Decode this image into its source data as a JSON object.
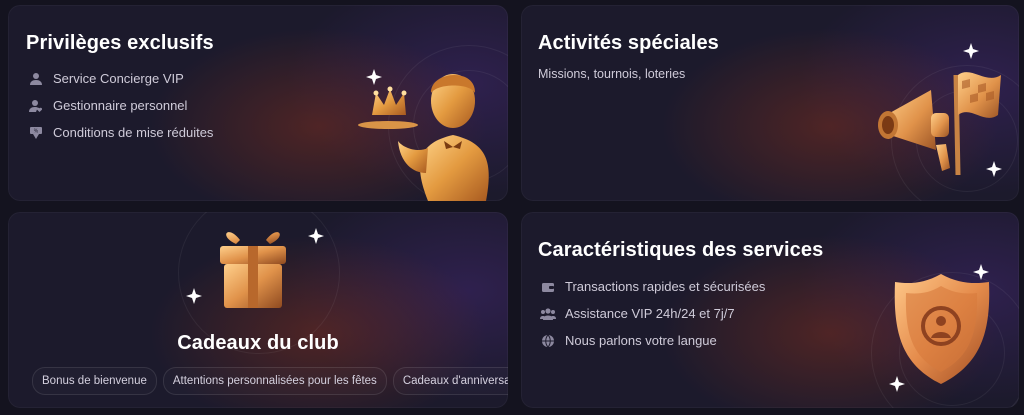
{
  "cards": {
    "privileges": {
      "title": "Privilèges exclusifs",
      "items": [
        {
          "label": "Service Concierge VIP",
          "icon": "person-icon"
        },
        {
          "label": "Gestionnaire personnel",
          "icon": "person-heart-icon"
        },
        {
          "label": "Conditions de mise réduites",
          "icon": "percent-banner-icon"
        }
      ]
    },
    "activities": {
      "title": "Activités spéciales",
      "subtitle": "Missions, tournois, loteries"
    },
    "gifts": {
      "title": "Cadeaux du club",
      "chips": [
        "Bonus de bienvenue",
        "Attentions personnalisées pour les fêtes",
        "Cadeaux d'anniversaire"
      ]
    },
    "services": {
      "title": "Caractéristiques des services",
      "items": [
        {
          "label": "Transactions rapides et sécurisées",
          "icon": "wallet-icon"
        },
        {
          "label": "Assistance VIP 24h/24 et 7j/7",
          "icon": "group-icon"
        },
        {
          "label": "Nous parlons votre langue",
          "icon": "globe-icon"
        }
      ]
    }
  },
  "colors": {
    "background": "#14131f",
    "card": "#1c1a2c",
    "gold": "#e8a24a",
    "text_muted": "#cfcbd9"
  }
}
